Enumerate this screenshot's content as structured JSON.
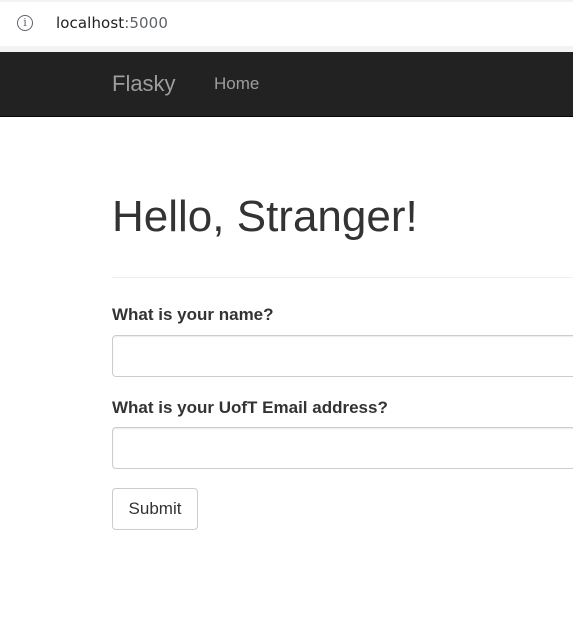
{
  "browser": {
    "url_host": "localhost",
    "url_port": ":5000",
    "info_icon_glyph": "i"
  },
  "navbar": {
    "brand": "Flasky",
    "home_link": "Home",
    "background": "#222222",
    "link_color": "#9d9d9d"
  },
  "main": {
    "title": "Hello, Stranger!",
    "form": {
      "name_label": "What is your name?",
      "name_value": "",
      "email_label": "What is your UofT Email address?",
      "email_value": "",
      "submit_label": "Submit"
    }
  }
}
